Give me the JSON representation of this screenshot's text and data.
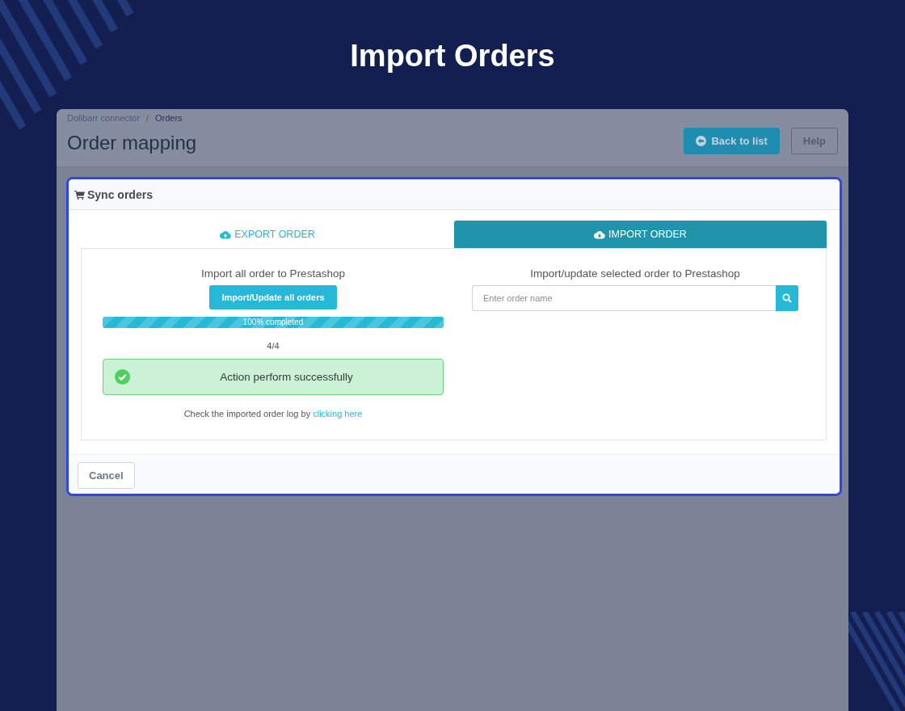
{
  "page_title": "Import Orders",
  "app_window": {
    "breadcrumb": {
      "items": [
        "Dolibarr connector",
        "Orders"
      ],
      "separator": "/"
    },
    "heading": "Order mapping",
    "header_buttons": [
      {
        "label": "Back to list",
        "kind": "primary"
      },
      {
        "label": "Help",
        "kind": "outline"
      }
    ],
    "panel": {
      "title": "Sync orders",
      "highlighted": true,
      "tabs": [
        {
          "label": "EXPORT ORDER",
          "selected": false
        },
        {
          "label": "IMPORT ORDER",
          "selected": true
        }
      ],
      "import_all": {
        "title": "Import all order to Prestashop",
        "button": "Import/Update all orders",
        "progress": {
          "level": 1,
          "label": "100% completed"
        },
        "count": "4/4",
        "alert": {
          "text": "Action perform successfully"
        },
        "log_note": {
          "text": "Check the imported order log by",
          "link": "clicking here"
        }
      },
      "import_selected": {
        "title": "Import/update selected order to Prestashop",
        "search": {
          "placeholder": "Enter order name"
        }
      },
      "footer_buttons": [
        "Cancel"
      ]
    }
  }
}
